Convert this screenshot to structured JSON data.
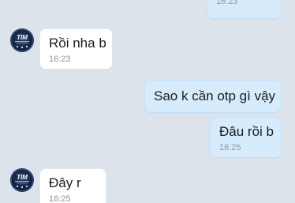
{
  "messages": [
    {
      "direction": "out",
      "text": "",
      "time": "16:23"
    },
    {
      "direction": "in",
      "text": "Rồi nha b",
      "time": "16:23"
    },
    {
      "direction": "out",
      "text": "Sao k cần otp gì vậy",
      "time": ""
    },
    {
      "direction": "out",
      "text": "Đâu rồi b",
      "time": "16:25"
    },
    {
      "direction": "in",
      "text": "Đây r",
      "time": "16:25"
    }
  ],
  "avatar": {
    "icon": "tim-logo-icon",
    "logo_text": "TIM"
  },
  "colors": {
    "background": "#dde3eb",
    "incoming_bubble": "#ffffff",
    "outgoing_bubble": "#d6ecfd",
    "timestamp": "#8e979f"
  }
}
